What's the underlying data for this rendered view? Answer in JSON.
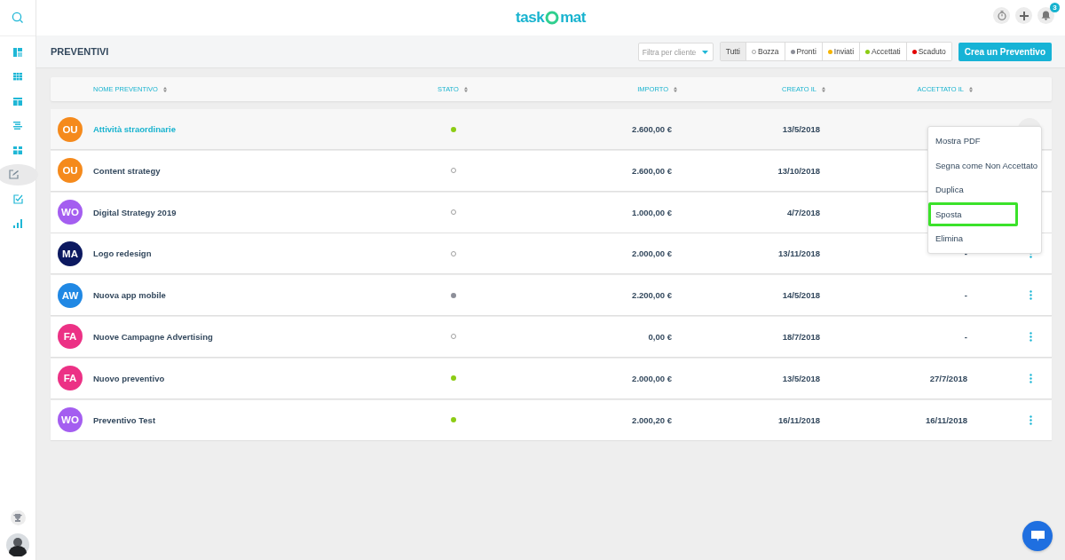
{
  "logo": {
    "parts": [
      "task",
      "mat"
    ]
  },
  "notifications": {
    "badge": "3"
  },
  "page_title": "PREVENTIVI",
  "client_filter": {
    "placeholder": "Filtra per cliente"
  },
  "status_filters": [
    {
      "label": "Tutti",
      "selected": true
    },
    {
      "label": "Bozza",
      "dot": {
        "kind": "outline"
      },
      "selected": false
    },
    {
      "label": "Pronti",
      "dot": {
        "kind": "filled",
        "color": "#8d8f99"
      },
      "selected": false
    },
    {
      "label": "Inviati",
      "dot": {
        "kind": "filled",
        "color": "#f5b400"
      },
      "selected": false
    },
    {
      "label": "Accettati",
      "dot": {
        "kind": "filled",
        "color": "#8ccc14"
      },
      "selected": false
    },
    {
      "label": "Scaduto",
      "dot": {
        "kind": "filled",
        "color": "#e30000"
      },
      "selected": false
    }
  ],
  "create_button": "Crea un Preventivo",
  "table": {
    "columns": [
      "NOME PREVENTIVO",
      "STATO",
      "IMPORTO",
      "CREATO IL",
      "ACCETTATO IL"
    ],
    "rows": [
      {
        "avatar": {
          "initials": "OU",
          "color": "#f58a1c"
        },
        "name": "Attività straordinarie",
        "status": {
          "kind": "filled",
          "color": "#8ccc14"
        },
        "amount": "2.600,00 €",
        "created": "13/5/2018",
        "selected": true
      },
      {
        "avatar": {
          "initials": "OU",
          "color": "#f58a1c"
        },
        "name": "Content strategy",
        "status": {
          "kind": "outline"
        },
        "amount": "2.600,00 €",
        "created": "13/10/2018",
        "selected": false
      },
      {
        "avatar": {
          "initials": "WO",
          "color": "#a45ef0"
        },
        "name": "Digital Strategy 2019",
        "status": {
          "kind": "outline"
        },
        "amount": "1.000,00 €",
        "created": "4/7/2018",
        "selected": false
      },
      {
        "avatar": {
          "initials": "MA",
          "color": "#0c1960"
        },
        "name": "Logo redesign",
        "status": {
          "kind": "outline"
        },
        "amount": "2.000,00 €",
        "created": "13/11/2018",
        "accepted": "-",
        "selected": false
      },
      {
        "avatar": {
          "initials": "AW",
          "color": "#2088e4"
        },
        "name": "Nuova app mobile",
        "status": {
          "kind": "filled",
          "color": "#8d8f99"
        },
        "amount": "2.200,00 €",
        "created": "14/5/2018",
        "accepted": "-",
        "selected": false
      },
      {
        "avatar": {
          "initials": "FA",
          "color": "#ec3185"
        },
        "name": "Nuove Campagne Advertising",
        "status": {
          "kind": "outline"
        },
        "amount": "0,00 €",
        "created": "18/7/2018",
        "accepted": "-",
        "selected": false
      },
      {
        "avatar": {
          "initials": "FA",
          "color": "#ec3185"
        },
        "name": "Nuovo preventivo",
        "status": {
          "kind": "filled",
          "color": "#8ccc14"
        },
        "amount": "2.000,00 €",
        "created": "13/5/2018",
        "accepted": "27/7/2018",
        "selected": false
      },
      {
        "avatar": {
          "initials": "WO",
          "color": "#a45ef0"
        },
        "name": "Preventivo Test",
        "status": {
          "kind": "filled",
          "color": "#8ccc14"
        },
        "amount": "2.000,20 €",
        "created": "16/11/2018",
        "accepted": "16/11/2018",
        "selected": false
      }
    ]
  },
  "row_menu": [
    {
      "label": "Mostra PDF",
      "selected": false
    },
    {
      "label": "Segna come Non Accettato",
      "selected": false
    },
    {
      "label": "Duplica",
      "selected": false
    },
    {
      "label": "Sposta",
      "selected": true
    },
    {
      "label": "Elimina",
      "selected": false
    }
  ]
}
